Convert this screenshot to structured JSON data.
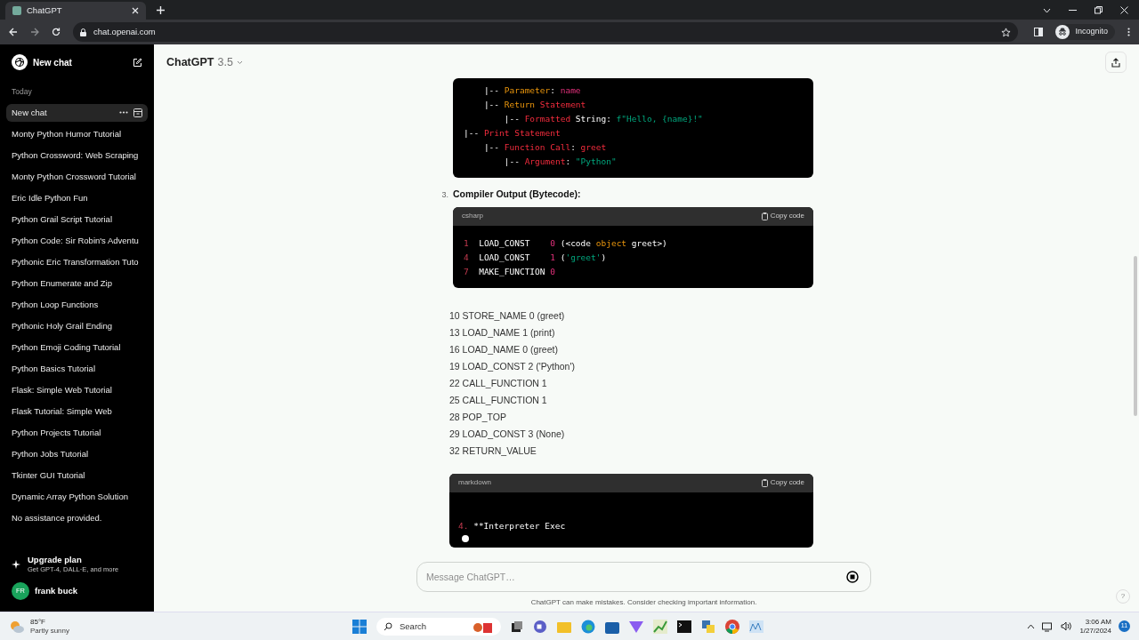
{
  "browser": {
    "tab_title": "ChatGPT",
    "url": "chat.openai.com",
    "profile_label": "Incognito"
  },
  "sidebar": {
    "new_chat_label": "New chat",
    "section": "Today",
    "items": [
      {
        "label": "New chat",
        "selected": true
      },
      {
        "label": "Monty Python Humor Tutorial",
        "selected": false
      },
      {
        "label": "Python Crossword: Web Scraping",
        "selected": false
      },
      {
        "label": "Monty Python Crossword Tutorial",
        "selected": false
      },
      {
        "label": "Eric Idle Python Fun",
        "selected": false
      },
      {
        "label": "Python Grail Script Tutorial",
        "selected": false
      },
      {
        "label": "Python Code: Sir Robin's Adventu",
        "selected": false
      },
      {
        "label": "Pythonic Eric Transformation Tuto",
        "selected": false
      },
      {
        "label": "Python Enumerate and Zip",
        "selected": false
      },
      {
        "label": "Python Loop Functions",
        "selected": false
      },
      {
        "label": "Pythonic Holy Grail Ending",
        "selected": false
      },
      {
        "label": "Python Emoji Coding Tutorial",
        "selected": false
      },
      {
        "label": "Python Basics Tutorial",
        "selected": false
      },
      {
        "label": "Flask: Simple Web Tutorial",
        "selected": false
      },
      {
        "label": "Flask Tutorial: Simple Web",
        "selected": false
      },
      {
        "label": "Python Projects Tutorial",
        "selected": false
      },
      {
        "label": "Python Jobs Tutorial",
        "selected": false
      },
      {
        "label": "Tkinter GUI Tutorial",
        "selected": false
      },
      {
        "label": "Dynamic Array Python Solution",
        "selected": false
      },
      {
        "label": "No assistance provided.",
        "selected": false
      }
    ],
    "upgrade": {
      "title": "Upgrade plan",
      "subtitle": "Get GPT-4, DALL·E, and more"
    },
    "user": {
      "initials": "FR",
      "name": "frank buck"
    }
  },
  "header": {
    "model": "ChatGPT",
    "version": "3.5"
  },
  "content": [
    {
      "kind": "code",
      "lines": [
        [
          {
            "text": "    |-- ",
            "kind": "plain"
          },
          {
            "text": "Parameter",
            "kind": "orange"
          },
          {
            "text": ": ",
            "kind": "plain"
          },
          {
            "text": "name",
            "kind": "pink"
          }
        ],
        [
          {
            "text": "    |-- ",
            "kind": "plain"
          },
          {
            "text": "Return",
            "kind": "orange"
          },
          {
            "text": " Statement",
            "kind": "red"
          }
        ],
        [
          {
            "text": "        |-- ",
            "kind": "plain"
          },
          {
            "text": "Formatted",
            "kind": "red"
          },
          {
            "text": " String: ",
            "kind": "plain"
          },
          {
            "text": "f\"Hello, {name}!\"",
            "kind": "green"
          }
        ],
        [
          {
            "text": "|-- ",
            "kind": "plain"
          },
          {
            "text": "Print Statement",
            "kind": "red"
          }
        ],
        [
          {
            "text": "    |-- ",
            "kind": "plain"
          },
          {
            "text": "Function Call",
            "kind": "red"
          },
          {
            "text": ": ",
            "kind": "plain"
          },
          {
            "text": "greet",
            "kind": "red"
          }
        ],
        [
          {
            "text": "        |-- ",
            "kind": "plain"
          },
          {
            "text": "Argument",
            "kind": "red"
          },
          {
            "text": ": ",
            "kind": "plain"
          },
          {
            "text": "\"Python\"",
            "kind": "green"
          }
        ]
      ]
    },
    {
      "kind": "heading",
      "number": "3.",
      "text": "Compiler Output (Bytecode):"
    },
    {
      "kind": "code",
      "language": "csharp",
      "copy_label": "Copy code",
      "lines": [
        [
          {
            "text": "1",
            "kind": "number"
          },
          {
            "text": "  LOAD_CONST    ",
            "kind": "plain"
          },
          {
            "text": "0",
            "kind": "pink"
          },
          {
            "text": " (<code ",
            "kind": "plain"
          },
          {
            "text": "object",
            "kind": "orange"
          },
          {
            "text": " greet>)",
            "kind": "plain"
          }
        ],
        [
          {
            "text": "4",
            "kind": "number"
          },
          {
            "text": "  LOAD_CONST    ",
            "kind": "plain"
          },
          {
            "text": "1",
            "kind": "pink"
          },
          {
            "text": " (",
            "kind": "plain"
          },
          {
            "text": "'greet'",
            "kind": "green"
          },
          {
            "text": ")",
            "kind": "plain"
          }
        ],
        [
          {
            "text": "7",
            "kind": "number"
          },
          {
            "text": "  MAKE_FUNCTION ",
            "kind": "plain"
          },
          {
            "text": "0",
            "kind": "pink"
          }
        ]
      ]
    },
    {
      "kind": "lines",
      "lines": [
        "10 STORE_NAME 0 (greet)",
        "13 LOAD_NAME 1 (print)",
        "16 LOAD_NAME 0 (greet)",
        "19 LOAD_CONST 2 ('Python')",
        "22 CALL_FUNCTION 1",
        "25 CALL_FUNCTION 1",
        "28 POP_TOP",
        "29 LOAD_CONST 3 (None)",
        "32 RETURN_VALUE"
      ]
    },
    {
      "kind": "code",
      "language": "markdown",
      "copy_label": "Copy code",
      "streaming": true,
      "lines": [
        [
          {
            "text": "4.",
            "kind": "number"
          },
          {
            "text": " **Interpreter Exec",
            "kind": "plain"
          }
        ]
      ]
    }
  ],
  "composer": {
    "placeholder": "Message ChatGPT…",
    "disclaimer": "ChatGPT can make mistakes. Consider checking important information.",
    "help": "?"
  },
  "taskbar": {
    "temperature": "85°F",
    "weather": "Partly sunny",
    "search": "Search",
    "time": "3:06 AM",
    "date": "1/27/2024",
    "notifications": "11"
  }
}
